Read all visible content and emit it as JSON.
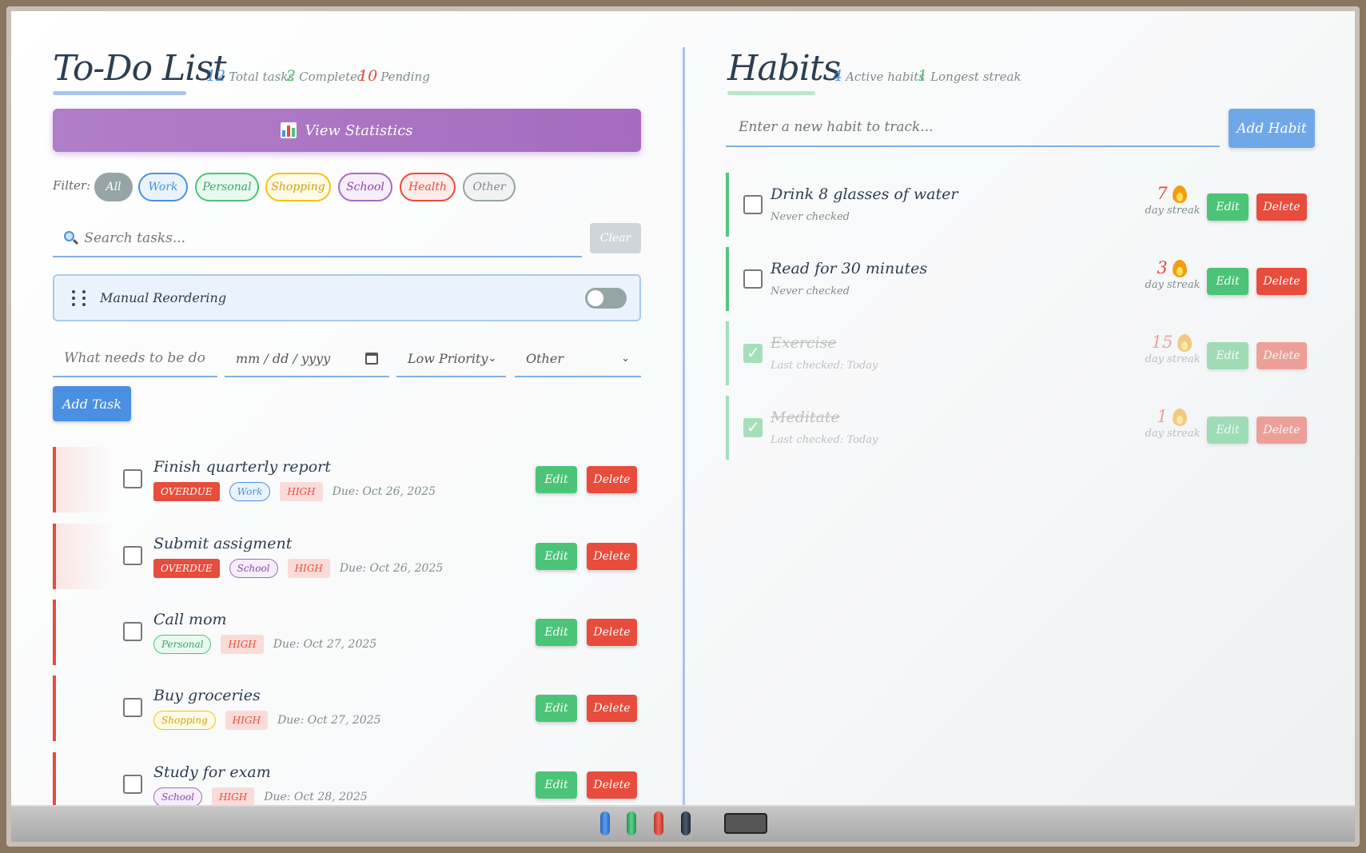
{
  "todo": {
    "title": "To-Do List",
    "stats": {
      "total": "12",
      "total_label": "Total tasks",
      "completed": "2",
      "completed_label": "Completed",
      "pending": "10",
      "pending_label": "Pending"
    },
    "view_stats_label": "View Statistics",
    "filter_label": "Filter:",
    "filters": [
      "All",
      "Work",
      "Personal",
      "Shopping",
      "School",
      "Health",
      "Other"
    ],
    "active_filter": "All",
    "search": {
      "placeholder": "Search tasks...",
      "clear_label": "Clear"
    },
    "reorder_label": "Manual Reordering",
    "reorder_enabled": false,
    "new_task": {
      "placeholder": "What needs to be done?",
      "date_placeholder": "mm / dd / yyyy",
      "priority": "Low Priority",
      "category": "Other",
      "add_label": "Add Task"
    },
    "tasks": [
      {
        "title": "Finish quarterly report",
        "overdue_label": "OVERDUE",
        "category": "Work",
        "priority": "HIGH",
        "due": "Due: Oct 26, 2025"
      },
      {
        "title": "Submit assigment",
        "overdue_label": "OVERDUE",
        "category": "School",
        "priority": "HIGH",
        "due": "Due: Oct 26, 2025"
      },
      {
        "title": "Call mom",
        "category": "Personal",
        "priority": "HIGH",
        "due": "Due: Oct 27, 2025"
      },
      {
        "title": "Buy groceries",
        "category": "Shopping",
        "priority": "HIGH",
        "due": "Due: Oct 27, 2025"
      },
      {
        "title": "Study for exam",
        "category": "School",
        "priority": "HIGH",
        "due": "Due: Oct 28, 2025"
      }
    ],
    "edit_label": "Edit",
    "delete_label": "Delete"
  },
  "habits": {
    "title": "Habits",
    "stats": {
      "active": "4",
      "active_label": "Active habits",
      "longest": "1",
      "longest_label": "Longest streak"
    },
    "input_placeholder": "Enter a new habit to track...",
    "add_label": "Add Habit",
    "streak_label": "day streak",
    "items": [
      {
        "name": "Drink 8 glasses of water",
        "sub": "Never checked",
        "streak": "7",
        "checked": false
      },
      {
        "name": "Read for 30 minutes",
        "sub": "Never checked",
        "streak": "3",
        "checked": false
      },
      {
        "name": "Exercise",
        "sub": "Last checked: Today",
        "streak": "15",
        "checked": true
      },
      {
        "name": "Meditate",
        "sub": "Last checked: Today",
        "streak": "1",
        "checked": true
      }
    ],
    "edit_label": "Edit",
    "delete_label": "Delete"
  },
  "colors": {
    "blue": "#4a90e2",
    "green": "#4cc477",
    "red": "#e74c3c",
    "purple": "#a56bbf",
    "marker_colors": [
      "#3b7dd8",
      "#3cb36b",
      "#e0493c",
      "#2c3e50"
    ]
  }
}
